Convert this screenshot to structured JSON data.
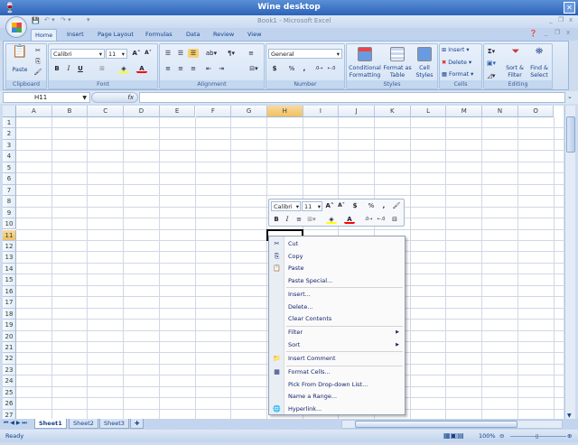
{
  "window": {
    "title": "Wine desktop",
    "close": "✕"
  },
  "app": {
    "title": "Book1 - Microsoft Excel",
    "min": "_",
    "restore": "❐",
    "close": "x"
  },
  "ribbon_tabs": [
    "Home",
    "Insert",
    "Page Layout",
    "Formulas",
    "Data",
    "Review",
    "View"
  ],
  "ribbon": {
    "clipboard": {
      "label": "Clipboard",
      "paste": "Paste"
    },
    "font": {
      "label": "Font",
      "font_name": "Calibri",
      "font_size": "11",
      "bold": "B",
      "italic": "I",
      "underline": "U",
      "font_color": "#ff0000",
      "fill_color": "#ffff00"
    },
    "alignment": {
      "label": "Alignment"
    },
    "number": {
      "label": "Number",
      "format": "General",
      "currency": "$",
      "percent": "%",
      "comma": ","
    },
    "styles": {
      "label": "Styles",
      "conditional": "Conditional Formatting",
      "format_table": "Format as Table",
      "cell_styles": "Cell Styles"
    },
    "cells": {
      "label": "Cells",
      "insert": "Insert",
      "delete": "Delete",
      "format": "Format"
    },
    "editing": {
      "label": "Editing",
      "sort": "Sort & Filter",
      "find": "Find & Select"
    }
  },
  "formula_bar": {
    "name_box": "H11",
    "fx": "fx",
    "value": ""
  },
  "grid": {
    "columns": [
      "A",
      "B",
      "C",
      "D",
      "E",
      "F",
      "G",
      "H",
      "I",
      "J",
      "K",
      "L",
      "M",
      "N",
      "O"
    ],
    "rows": 27,
    "selected_col": "H",
    "selected_row": 11
  },
  "mini_toolbar": {
    "font_name": "Calibri",
    "font_size": "11",
    "currency": "$",
    "percent": "%",
    "comma": ",",
    "bold": "B",
    "italic": "I"
  },
  "context_menu": [
    {
      "label": "Cut",
      "icon": "scissors-icon"
    },
    {
      "label": "Copy",
      "icon": "copy-icon"
    },
    {
      "label": "Paste",
      "icon": "paste-icon"
    },
    {
      "label": "Paste Special...",
      "sep_after": true
    },
    {
      "label": "Insert..."
    },
    {
      "label": "Delete..."
    },
    {
      "label": "Clear Contents",
      "sep_after": true
    },
    {
      "label": "Filter",
      "submenu": true
    },
    {
      "label": "Sort",
      "submenu": true,
      "sep_after": true
    },
    {
      "label": "Insert Comment",
      "icon": "comment-icon",
      "sep_after": true
    },
    {
      "label": "Format Cells...",
      "icon": "format-cells-icon"
    },
    {
      "label": "Pick From Drop-down List..."
    },
    {
      "label": "Name a Range..."
    },
    {
      "label": "Hyperlink...",
      "icon": "hyperlink-icon"
    }
  ],
  "sheets": [
    "Sheet1",
    "Sheet2",
    "Sheet3"
  ],
  "active_sheet": "Sheet1",
  "status": {
    "text": "Ready",
    "zoom": "100%"
  }
}
